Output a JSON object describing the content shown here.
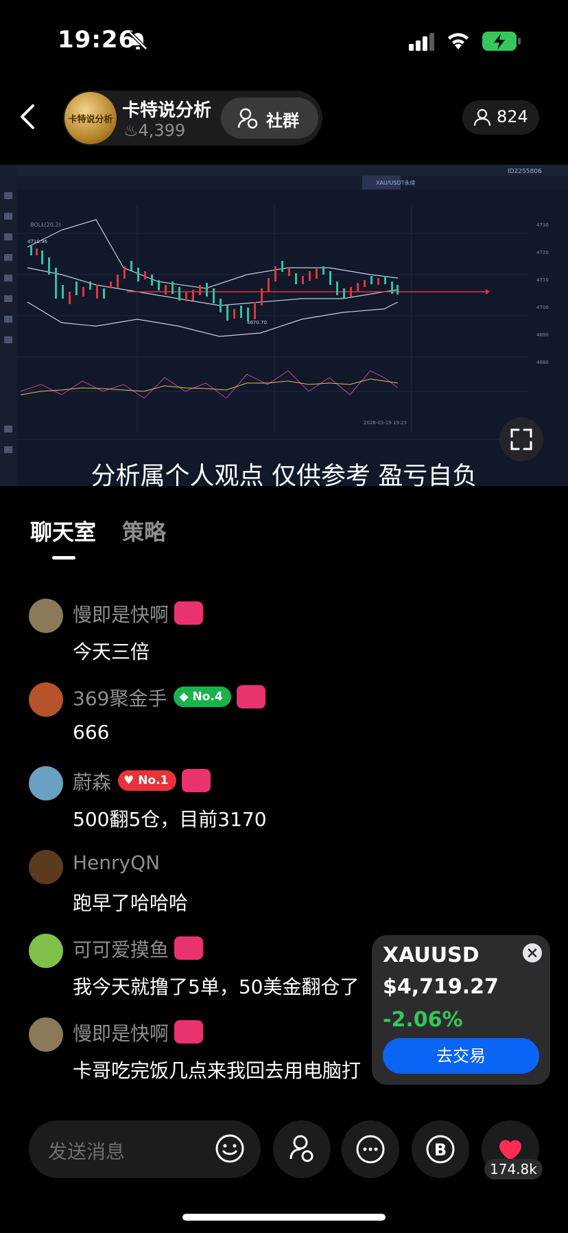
{
  "status_bar": {
    "time": "19:26"
  },
  "host": {
    "name": "卡特说分析",
    "avatar_text": "卡特说分析",
    "likes": "4,399",
    "group_label": "社群",
    "viewer_count": "824"
  },
  "stream": {
    "caption": "分析属个人观点 仅供参考 盈亏自负",
    "chart_labels": {
      "symbol": "XAU/USDT永续",
      "boll": "BOLL(20,2)",
      "low_label": "4670.70",
      "high_label": "4710.96",
      "date_label": "2026-03-19 19:23",
      "user_id": "ID2255806"
    }
  },
  "tabs": [
    {
      "label": "聊天室"
    },
    {
      "label": "策略"
    }
  ],
  "messages": [
    {
      "user": "慢即是快啊",
      "text": "今天三倍",
      "avatar_color": "#8a7a5a"
    },
    {
      "user": "369聚金手",
      "badge": "No.4",
      "badge_color": "#19b34a",
      "text": "666",
      "avatar_color": "#b5542b"
    },
    {
      "user": "蔚森",
      "badge": "No.1",
      "badge_color": "#e8333b",
      "text": "500翻5仓，目前3170",
      "avatar_color": "#6aa0c0"
    },
    {
      "user": "HenryQN",
      "text": "跑早了哈哈哈",
      "avatar_color": "#5c3a1c"
    },
    {
      "user": "可可爱摸鱼",
      "text": "我今天就撸了5单，50美金翻仓了",
      "avatar_color": "#7fc04a"
    },
    {
      "user": "慢即是快啊",
      "text": "卡哥吃完饭几点来我回去用电脑打",
      "avatar_color": "#8a7a5a"
    }
  ],
  "quote_card": {
    "symbol": "XAUUSD",
    "price": "$4,719.27",
    "change": "-2.06%",
    "change_color": "#34c759",
    "button": "去交易"
  },
  "bottom_bar": {
    "input_placeholder": "发送消息",
    "like_count": "174.8k"
  },
  "colors": {
    "accent_pink": "#e8336f",
    "accent_blue": "#0a64f5"
  }
}
